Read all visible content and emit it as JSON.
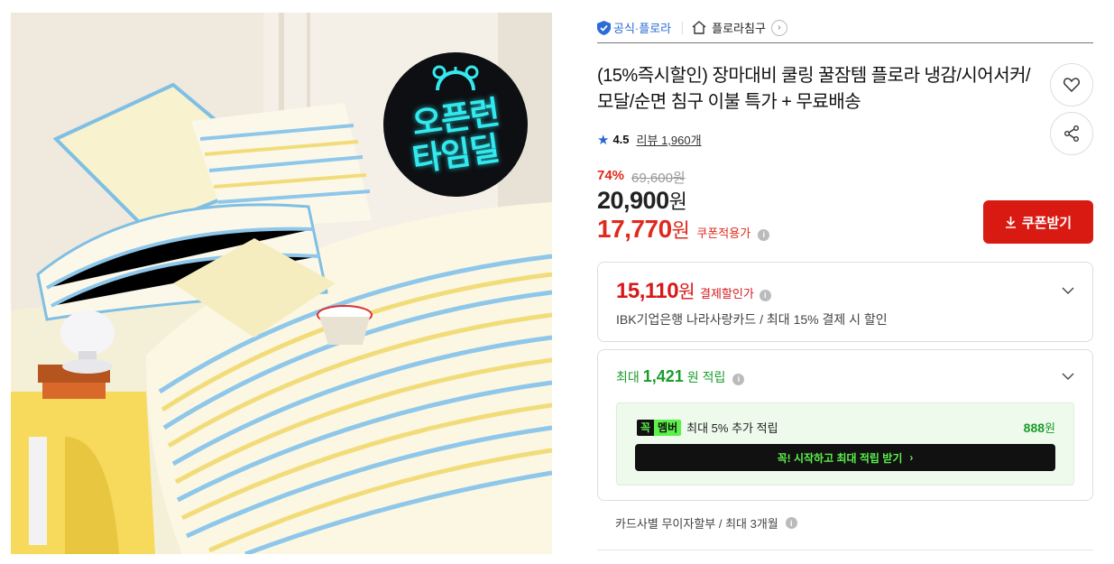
{
  "image": {
    "badge_line1": "오픈런",
    "badge_line2": "타임딜"
  },
  "topbar": {
    "official_label": "공식·플로라",
    "store_label": "플로라침구"
  },
  "product": {
    "title": "(15%즉시할인) 장마대비 쿨링 꿀잠템 플로라 냉감/시어서커/모달/순면 침구 이불 특가 + 무료배송"
  },
  "rating": {
    "score": "4.5",
    "review_label": "리뷰 1,960개"
  },
  "price": {
    "discount_rate": "74%",
    "original": "69,600원",
    "sale_amount": "20,900",
    "sale_unit": "원",
    "coupon_amount": "17,770",
    "coupon_unit": "원",
    "coupon_label": "쿠폰적용가"
  },
  "coupon_button": {
    "label": "쿠폰받기"
  },
  "payment": {
    "amount": "15,110",
    "unit": "원",
    "label": "결제할인가",
    "desc": "IBK기업은행 나라사랑카드 / 최대 15% 결제 시 할인"
  },
  "points": {
    "prefix": "최대",
    "amount": "1,421",
    "suffix": "원 적립",
    "member_badge_1": "꼭",
    "member_badge_2": "멤버",
    "member_text": "최대 5% 추가 적립",
    "member_amount": "888",
    "member_unit": "원",
    "member_button": "꼭! 시작하고 최대 적립 받기"
  },
  "installment": {
    "text": "카드사별 무이자할부 / 최대 3개월"
  },
  "colors": {
    "price_red": "#e0281d",
    "coupon_btn": "#d91a13",
    "point_green": "#1a9c2c",
    "member_green": "#5bf04a",
    "official_blue": "#2a6bd6"
  }
}
